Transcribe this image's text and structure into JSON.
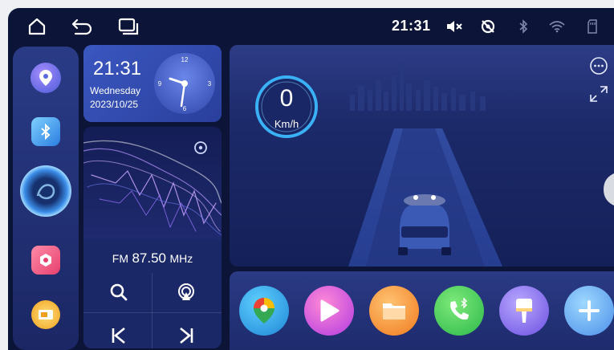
{
  "status_bar": {
    "time": "21:31",
    "icons": [
      "home-icon",
      "back-icon",
      "recent-apps-icon",
      "mute-icon",
      "no-gps-icon",
      "bluetooth-icon",
      "wifi-icon",
      "sd-card-icon"
    ]
  },
  "dock": {
    "apps": [
      "maps-app",
      "bluetooth-app",
      "assistant-app",
      "camera-app",
      "multiwindow-app"
    ]
  },
  "clock_widget": {
    "time": "21:31",
    "day": "Wednesday",
    "date": "2023/10/25",
    "dial_numbers": [
      "12",
      "3",
      "6",
      "9"
    ]
  },
  "radio_widget": {
    "band": "FM",
    "frequency": "87.50",
    "unit": "MHz"
  },
  "drive_panel": {
    "speed": "0",
    "speed_unit": "Km/h"
  },
  "app_bar": {
    "apps": [
      "google-maps-app",
      "video-player-app",
      "file-manager-app",
      "phone-app",
      "paint-app",
      "add-app"
    ]
  },
  "colors": {
    "background": "#0c1437",
    "panel": "#1b2868",
    "accent": "#38a8f0",
    "highlight": "#8e5cf0"
  }
}
